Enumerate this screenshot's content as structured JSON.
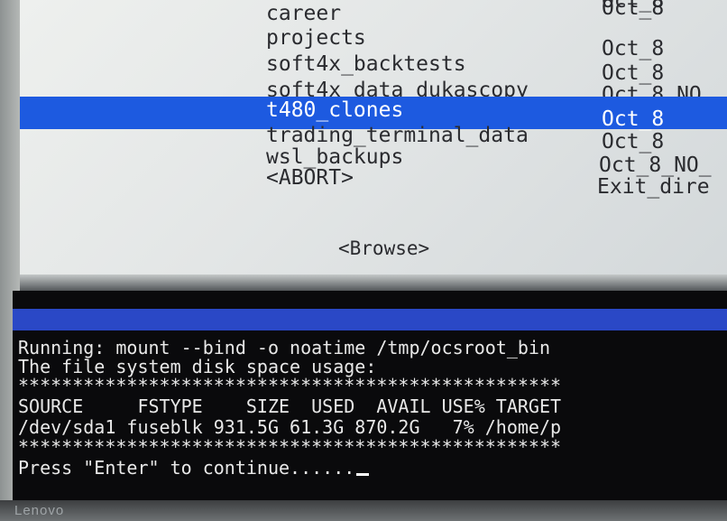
{
  "dialog": {
    "top_partial_date": "Oct_8",
    "items": [
      {
        "name": "career",
        "date": "Oct_8"
      },
      {
        "name": "projects",
        "date": "Oct_8"
      },
      {
        "name": "soft4x_backtests",
        "date": "Oct_8"
      },
      {
        "name": "soft4x_data_dukascopy",
        "date": "Oct_8_NO"
      },
      {
        "name": "t480_clones",
        "date": "Oct_8"
      },
      {
        "name": "trading_terminal_data",
        "date": "Oct_8"
      },
      {
        "name": "wsl_backups",
        "date": "Oct_8_NO_"
      },
      {
        "name": "<ABORT>",
        "date": "Exit_dire"
      }
    ],
    "selected_index": 4,
    "browse_button": "<Browse>"
  },
  "terminal": {
    "lines": [
      "Running: mount --bind -o noatime /tmp/ocsroot_bin",
      "The file system disk space usage:",
      "**************************************************",
      "SOURCE     FSTYPE    SIZE  USED  AVAIL USE% TARGET",
      "/dev/sda1 fuseblk 931.5G 61.3G 870.2G   7% /home/p",
      "**************************************************",
      "Press \"Enter\" to continue......"
    ]
  },
  "bezel": {
    "logo": "Lenovo"
  }
}
